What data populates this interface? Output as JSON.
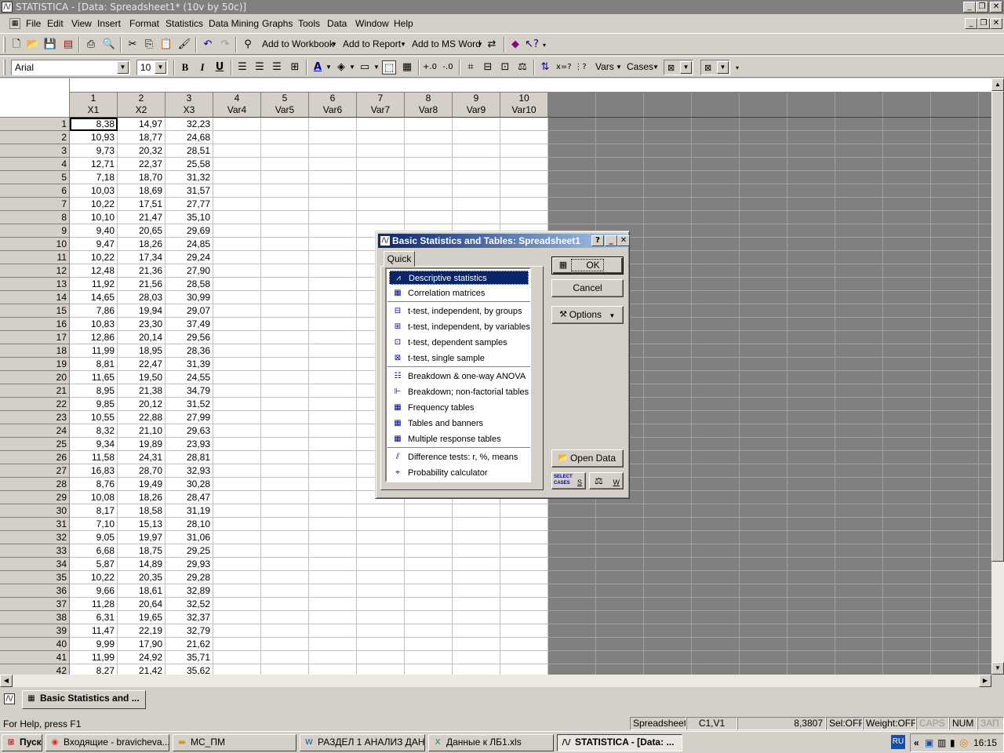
{
  "app": {
    "title": "STATISTICA - [Data: Spreadsheet1* (10v by 50c)]"
  },
  "menu": [
    "File",
    "Edit",
    "View",
    "Insert",
    "Format",
    "Statistics",
    "Data Mining",
    "Graphs",
    "Tools",
    "Data",
    "Window",
    "Help"
  ],
  "toolbar1": {
    "add_workbook": "Add to Workbook",
    "add_report": "Add to Report",
    "add_msword": "Add to MS Word"
  },
  "toolbar2": {
    "font": "Arial",
    "size": "10",
    "bold": "B",
    "italic": "I",
    "underline": "U",
    "vars": "Vars",
    "cases": "Cases"
  },
  "sheet": {
    "columns": [
      {
        "num": "1",
        "name": "X1"
      },
      {
        "num": "2",
        "name": "X2"
      },
      {
        "num": "3",
        "name": "X3"
      },
      {
        "num": "4",
        "name": "Var4"
      },
      {
        "num": "5",
        "name": "Var5"
      },
      {
        "num": "6",
        "name": "Var6"
      },
      {
        "num": "7",
        "name": "Var7"
      },
      {
        "num": "8",
        "name": "Var8"
      },
      {
        "num": "9",
        "name": "Var9"
      },
      {
        "num": "10",
        "name": "Var10"
      }
    ],
    "rows": [
      [
        "8,38",
        "14,97",
        "32,23"
      ],
      [
        "10,93",
        "18,77",
        "24,68"
      ],
      [
        "9,73",
        "20,32",
        "28,51"
      ],
      [
        "12,71",
        "22,37",
        "25,58"
      ],
      [
        "7,18",
        "18,70",
        "31,32"
      ],
      [
        "10,03",
        "18,69",
        "31,57"
      ],
      [
        "10,22",
        "17,51",
        "27,77"
      ],
      [
        "10,10",
        "21,47",
        "35,10"
      ],
      [
        "9,40",
        "20,65",
        "29,69"
      ],
      [
        "9,47",
        "18,26",
        "24,85"
      ],
      [
        "10,22",
        "17,34",
        "29,24"
      ],
      [
        "12,48",
        "21,36",
        "27,90"
      ],
      [
        "11,92",
        "21,56",
        "28,58"
      ],
      [
        "14,65",
        "28,03",
        "30,99"
      ],
      [
        "7,86",
        "19,94",
        "29,07"
      ],
      [
        "10,83",
        "23,30",
        "37,49"
      ],
      [
        "12,86",
        "20,14",
        "29,56"
      ],
      [
        "11,99",
        "18,95",
        "28,36"
      ],
      [
        "8,81",
        "22,47",
        "31,39"
      ],
      [
        "11,65",
        "19,50",
        "24,55"
      ],
      [
        "8,95",
        "21,38",
        "34,79"
      ],
      [
        "9,85",
        "20,12",
        "31,52"
      ],
      [
        "10,55",
        "22,88",
        "27,99"
      ],
      [
        "8,32",
        "21,10",
        "29,63"
      ],
      [
        "9,34",
        "19,89",
        "23,93"
      ],
      [
        "11,58",
        "24,31",
        "28,81"
      ],
      [
        "16,83",
        "28,70",
        "32,93"
      ],
      [
        "8,76",
        "19,49",
        "30,28"
      ],
      [
        "10,08",
        "18,26",
        "28,47"
      ],
      [
        "8,17",
        "18,58",
        "31,19"
      ],
      [
        "7,10",
        "15,13",
        "28,10"
      ],
      [
        "9,05",
        "19,97",
        "31,06"
      ],
      [
        "6,68",
        "18,75",
        "29,25"
      ],
      [
        "5,87",
        "14,89",
        "29,93"
      ],
      [
        "10,22",
        "20,35",
        "29,28"
      ],
      [
        "9,66",
        "18,61",
        "32,89"
      ],
      [
        "11,28",
        "20,64",
        "32,52"
      ],
      [
        "6,31",
        "19,65",
        "32,37"
      ],
      [
        "11,47",
        "22,19",
        "32,79"
      ],
      [
        "9,99",
        "17,90",
        "21,62"
      ],
      [
        "11,99",
        "24,92",
        "35,71"
      ],
      [
        "8,27",
        "21,42",
        "35,62"
      ]
    ]
  },
  "dialog": {
    "title": "Basic Statistics and Tables: Spreadsheet1",
    "tab": "Quick",
    "items": [
      {
        "label": "Descriptive statistics",
        "selected": true,
        "icon": "descriptive-icon"
      },
      {
        "label": "Correlation matrices",
        "icon": "matrix-icon"
      },
      {
        "label": "t-test, independent, by groups",
        "icon": "ttest-groups-icon"
      },
      {
        "label": "t-test, independent, by variables",
        "icon": "ttest-vars-icon"
      },
      {
        "label": "t-test, dependent samples",
        "icon": "ttest-dep-icon"
      },
      {
        "label": "t-test, single sample",
        "icon": "ttest-single-icon"
      },
      {
        "label": "Breakdown & one-way ANOVA",
        "icon": "breakdown-icon"
      },
      {
        "label": "Breakdown; non-factorial tables",
        "icon": "breakdown-nf-icon"
      },
      {
        "label": "Frequency tables",
        "icon": "frequency-icon"
      },
      {
        "label": "Tables and banners",
        "icon": "tables-icon"
      },
      {
        "label": "Multiple response tables",
        "icon": "multiple-icon"
      },
      {
        "label": "Difference tests: r, %, means",
        "icon": "difference-icon"
      },
      {
        "label": "Probability calculator",
        "icon": "probability-icon"
      }
    ],
    "ok": "OK",
    "cancel": "Cancel",
    "options": "Options",
    "open_data": "Open Data",
    "select_cases_line1": "SELECT",
    "select_cases_line2": "CASES",
    "s_label": "S",
    "w_label": "W"
  },
  "mdi": {
    "task": "Basic Statistics and ..."
  },
  "status": {
    "help": "For Help, press F1",
    "sheet": "Spreadsheet1",
    "cell": "C1,V1",
    "value": "8,3807",
    "sel": "Sel:OFF",
    "weight": "Weight:OFF",
    "caps": "CAPS",
    "num": "NUM",
    "scroll": "ЗАП"
  },
  "taskbar": {
    "start": "Пуск",
    "tasks": [
      "Входящие - bravicheva...",
      "МС_ПМ",
      "РАЗДЕЛ 1 АНАЛИЗ ДАН...",
      "Данные к ЛБ1.xls",
      "STATISTICA - [Data: ..."
    ],
    "lang": "RU",
    "clock": "16:15"
  }
}
